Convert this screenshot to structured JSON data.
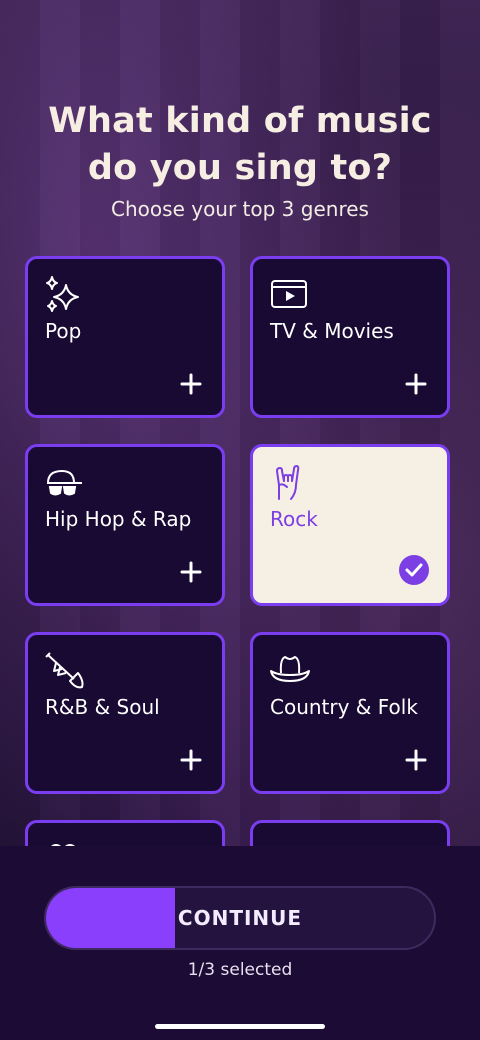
{
  "header": {
    "title_line1": "What kind of music",
    "title_line2": "do you sing to?",
    "subtitle": "Choose your top 3 genres"
  },
  "genres": [
    {
      "label": "Pop",
      "icon": "sparkles-icon",
      "selected": false
    },
    {
      "label": "TV & Movies",
      "icon": "video-player-icon",
      "selected": false
    },
    {
      "label": "Hip Hop & Rap",
      "icon": "cap-sunglasses-icon",
      "selected": false
    },
    {
      "label": "Rock",
      "icon": "rock-hand-icon",
      "selected": true
    },
    {
      "label": "R&B & Soul",
      "icon": "trumpet-icon",
      "selected": false
    },
    {
      "label": "Country & Folk",
      "icon": "cowboy-hat-icon",
      "selected": false
    },
    {
      "label": "",
      "icon": "partial-icon",
      "selected": false
    },
    {
      "label": "",
      "icon": "partial-icon",
      "selected": false
    }
  ],
  "footer": {
    "continue_label": "CONTINUE",
    "selected_count": "1/3 selected",
    "progress_fraction": 0.3333
  },
  "colors": {
    "accent": "#8a3ffc",
    "card_border": "#7a3ef0",
    "card_bg": "#180a33",
    "selected_bg": "#f6efe3"
  }
}
